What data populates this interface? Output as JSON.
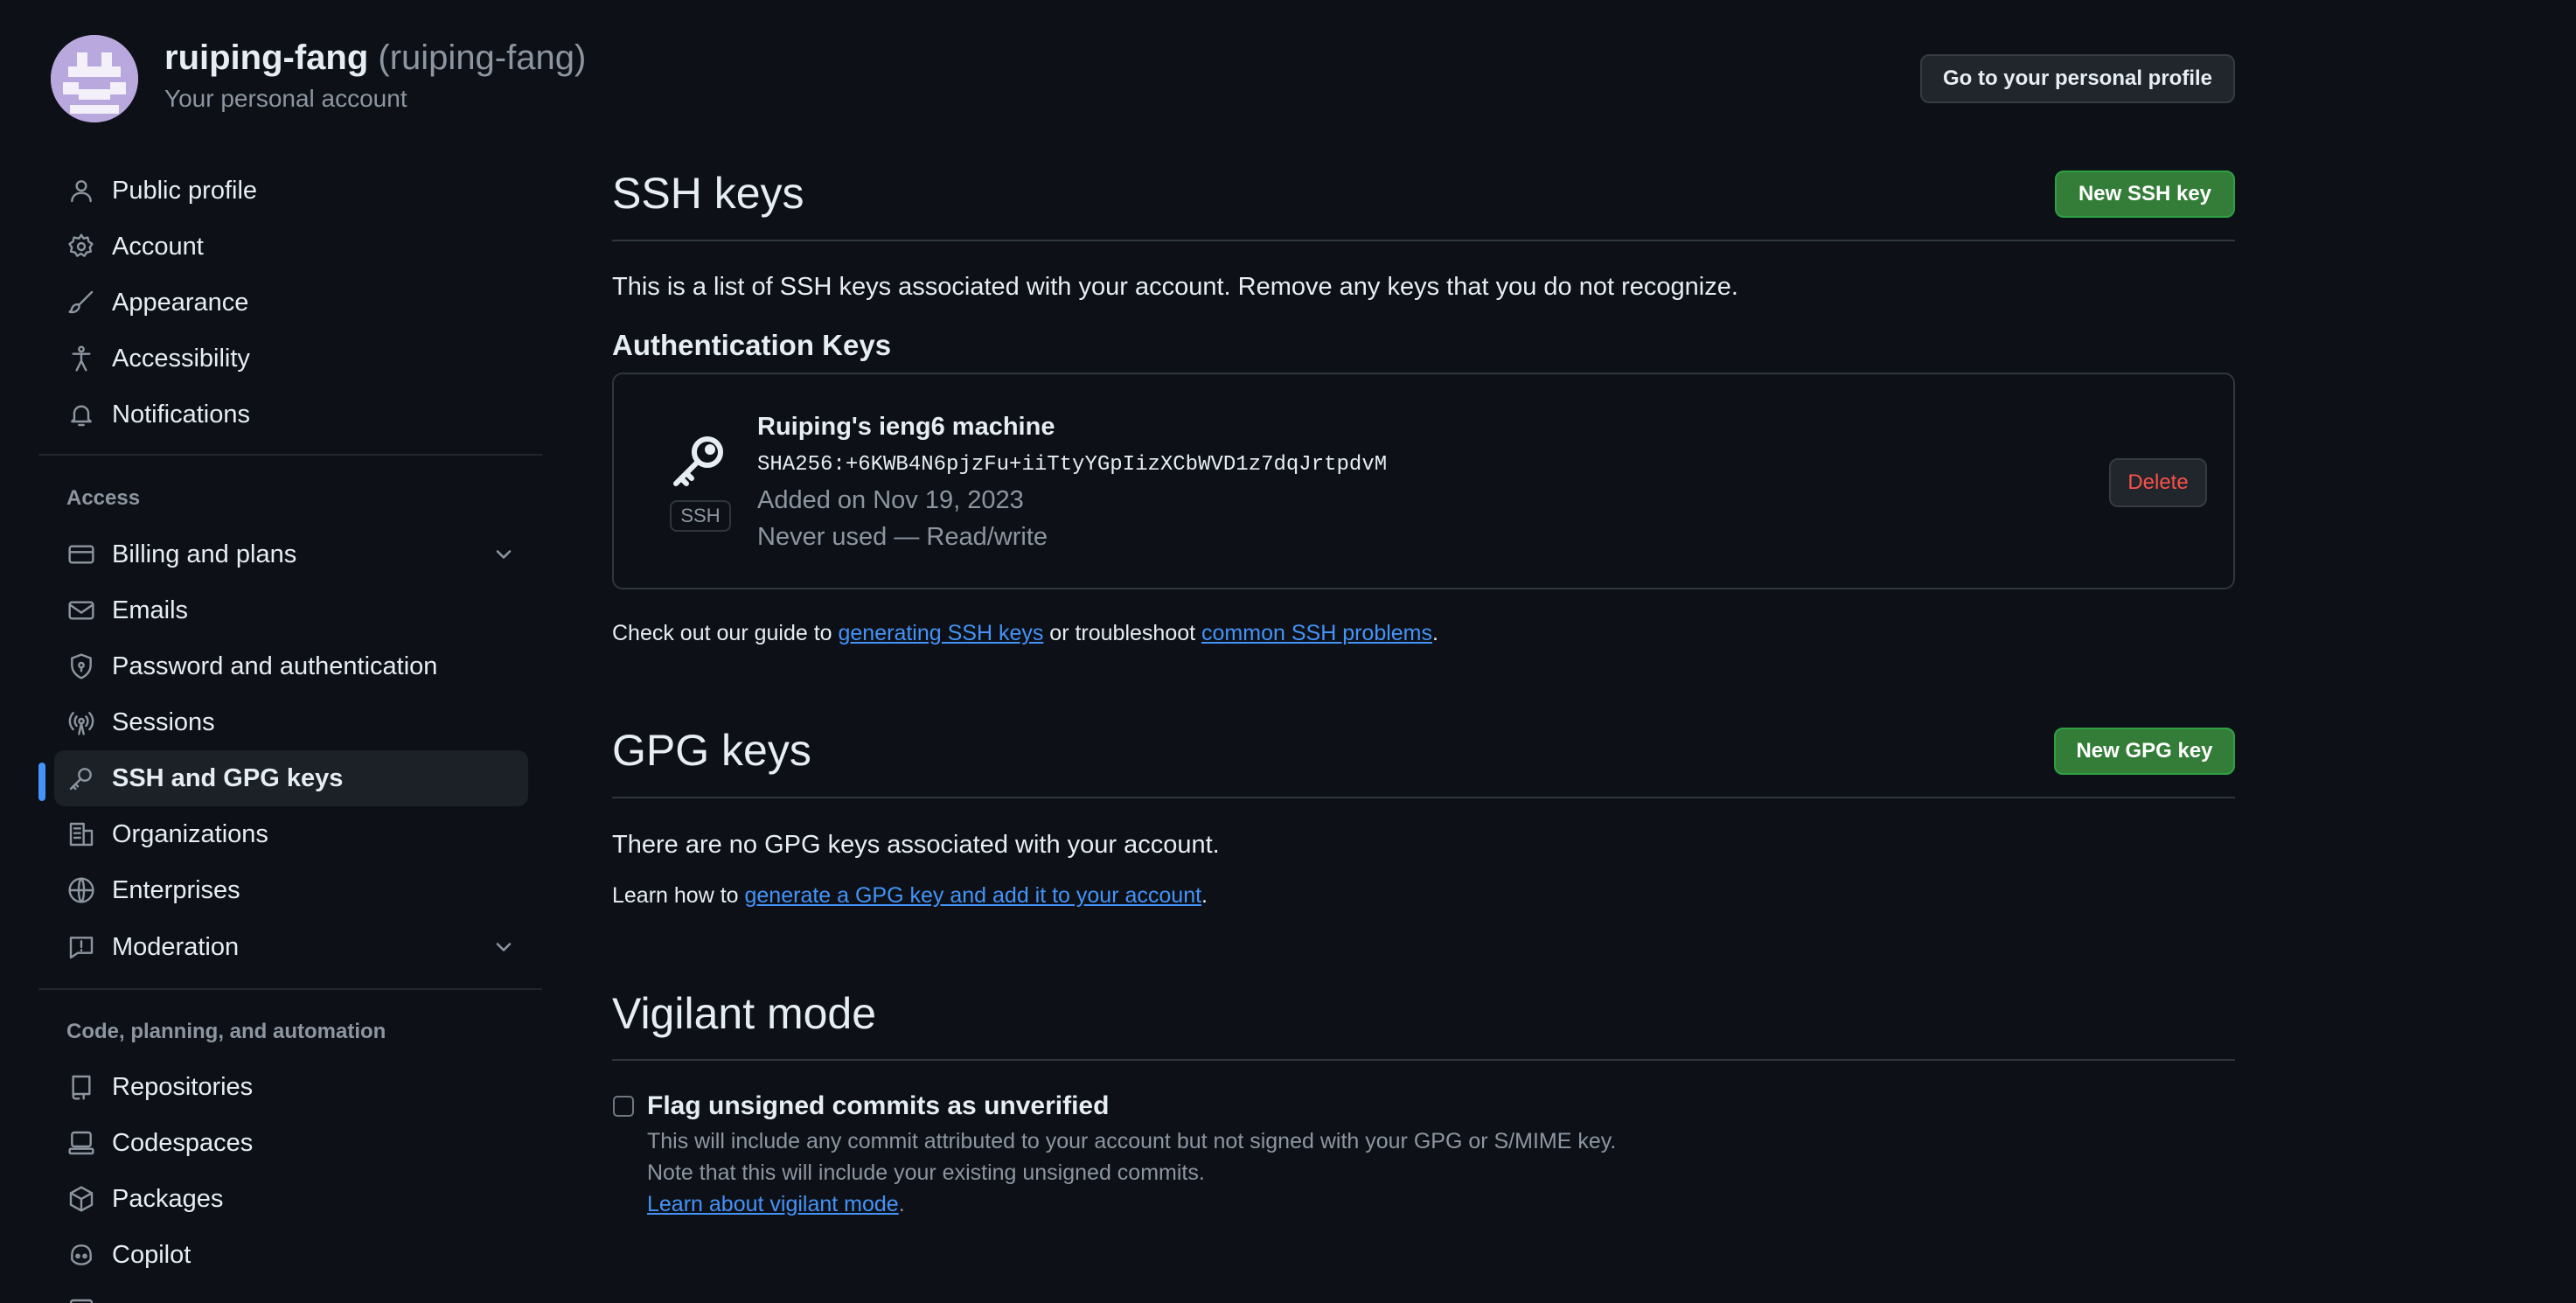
{
  "account": {
    "name": "ruiping-fang",
    "handle": "(ruiping-fang)",
    "subtitle": "Your personal account",
    "profile_button": "Go to your personal profile"
  },
  "sidebar": {
    "top_items": [
      {
        "label": "Public profile",
        "icon": "person-icon"
      },
      {
        "label": "Account",
        "icon": "gear-icon"
      },
      {
        "label": "Appearance",
        "icon": "paintbrush-icon"
      },
      {
        "label": "Accessibility",
        "icon": "accessibility-icon"
      },
      {
        "label": "Notifications",
        "icon": "bell-icon"
      }
    ],
    "access_heading": "Access",
    "access_items": [
      {
        "label": "Billing and plans",
        "icon": "credit-card-icon",
        "expandable": true
      },
      {
        "label": "Emails",
        "icon": "mail-icon"
      },
      {
        "label": "Password and authentication",
        "icon": "shield-lock-icon"
      },
      {
        "label": "Sessions",
        "icon": "broadcast-icon"
      },
      {
        "label": "SSH and GPG keys",
        "icon": "key-icon",
        "active": true
      },
      {
        "label": "Organizations",
        "icon": "organization-icon"
      },
      {
        "label": "Enterprises",
        "icon": "globe-icon"
      },
      {
        "label": "Moderation",
        "icon": "report-icon",
        "expandable": true
      }
    ],
    "code_heading": "Code, planning, and automation",
    "code_items": [
      {
        "label": "Repositories",
        "icon": "repo-icon"
      },
      {
        "label": "Codespaces",
        "icon": "codespaces-icon"
      },
      {
        "label": "Packages",
        "icon": "package-icon"
      },
      {
        "label": "Copilot",
        "icon": "copilot-icon"
      }
    ]
  },
  "ssh": {
    "title": "SSH keys",
    "new_button": "New SSH key",
    "description": "This is a list of SSH keys associated with your account. Remove any keys that you do not recognize.",
    "auth_heading": "Authentication Keys",
    "key": {
      "title": "Ruiping's ieng6 machine",
      "fingerprint": "SHA256:+6KWB4N6pjzFu+iiTtyYGpIizXCbWVD1z7dqJrtpdvM",
      "added": "Added on Nov 19, 2023",
      "usage": "Never used — Read/write",
      "badge": "SSH",
      "delete_button": "Delete"
    },
    "guide_prefix": "Check out our guide to ",
    "guide_link1": "generating SSH keys",
    "guide_middle": " or troubleshoot ",
    "guide_link2": "common SSH problems",
    "guide_suffix": "."
  },
  "gpg": {
    "title": "GPG keys",
    "new_button": "New GPG key",
    "empty_text": "There are no GPG keys associated with your account.",
    "learn_prefix": "Learn how to ",
    "learn_link": "generate a GPG key and add it to your account",
    "learn_suffix": "."
  },
  "vigilant": {
    "title": "Vigilant mode",
    "checkbox_label": "Flag unsigned commits as unverified",
    "checked": false,
    "help_line1": "This will include any commit attributed to your account but not signed with your GPG or S/MIME key.",
    "help_line2": "Note that this will include your existing unsigned commits.",
    "help_link": "Learn about vigilant mode",
    "help_suffix": "."
  },
  "colors": {
    "background": "#0d1117",
    "primary_button": "#347d39",
    "link": "#4493f8",
    "active_marker": "#4493f8",
    "danger": "#f85149"
  }
}
